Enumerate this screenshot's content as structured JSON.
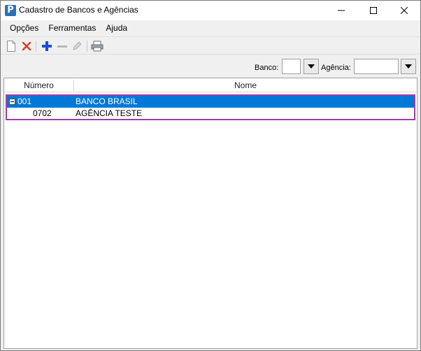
{
  "window": {
    "title": "Cadastro de Bancos e Agências",
    "app_icon_letter": "P"
  },
  "menu": [
    "Opções",
    "Ferramentas",
    "Ajuda"
  ],
  "toolbar": {
    "buttons": [
      "new-document-icon",
      "delete-icon",
      "add-icon",
      "remove-icon",
      "edit-icon",
      "print-icon"
    ]
  },
  "filters": {
    "banco_label": "Banco:",
    "banco_value": "",
    "agencia_label": "Agência:",
    "agencia_value": ""
  },
  "grid": {
    "columns": [
      "Número",
      "Nome"
    ],
    "rows": [
      {
        "numero": "001",
        "nome": "BANCO BRASIL",
        "level": 0,
        "expanded": true,
        "selected": true
      },
      {
        "numero": "0702",
        "nome": "AGÊNCIA TESTE",
        "level": 1,
        "expanded": false,
        "selected": false
      }
    ]
  },
  "colors": {
    "selection": "#0078d7",
    "highlight_frame": "#9b3fa6",
    "add_icon": "#1a4fd0",
    "delete_icon": "#e03a1e"
  }
}
